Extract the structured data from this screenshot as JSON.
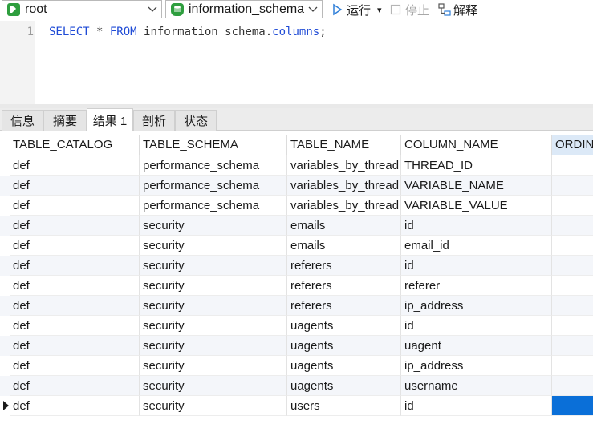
{
  "toolbar": {
    "connection": "root",
    "database": "information_schema",
    "run_label": "运行",
    "run_dropdown": "▾",
    "stop_label": "停止",
    "explain_label": "解释"
  },
  "editor": {
    "line_number": "1",
    "sql": {
      "kw1": "SELECT",
      "star": " * ",
      "kw2": "FROM",
      "schema": " information_schema.",
      "table": "columns",
      "end": ";"
    }
  },
  "tabs": [
    "信息",
    "摘要",
    "结果 1",
    "剖析",
    "状态"
  ],
  "active_tab": "结果 1",
  "grid": {
    "columns": [
      "TABLE_CATALOG",
      "TABLE_SCHEMA",
      "TABLE_NAME",
      "COLUMN_NAME",
      "ORDIN"
    ],
    "rows": [
      [
        "def",
        "performance_schema",
        "variables_by_thread",
        "THREAD_ID",
        ""
      ],
      [
        "def",
        "performance_schema",
        "variables_by_thread",
        "VARIABLE_NAME",
        ""
      ],
      [
        "def",
        "performance_schema",
        "variables_by_thread",
        "VARIABLE_VALUE",
        ""
      ],
      [
        "def",
        "security",
        "emails",
        "id",
        ""
      ],
      [
        "def",
        "security",
        "emails",
        "email_id",
        ""
      ],
      [
        "def",
        "security",
        "referers",
        "id",
        ""
      ],
      [
        "def",
        "security",
        "referers",
        "referer",
        ""
      ],
      [
        "def",
        "security",
        "referers",
        "ip_address",
        ""
      ],
      [
        "def",
        "security",
        "uagents",
        "id",
        ""
      ],
      [
        "def",
        "security",
        "uagents",
        "uagent",
        ""
      ],
      [
        "def",
        "security",
        "uagents",
        "ip_address",
        ""
      ],
      [
        "def",
        "security",
        "uagents",
        "username",
        ""
      ],
      [
        "def",
        "security",
        "users",
        "id",
        ""
      ]
    ]
  },
  "colors": {
    "accent": "#0a6fd8",
    "header_selected": "#dce9f7",
    "keyword": "#1f4bd6",
    "connection_icon": "#2e9e3e",
    "database_icon": "#2e9e3e"
  }
}
